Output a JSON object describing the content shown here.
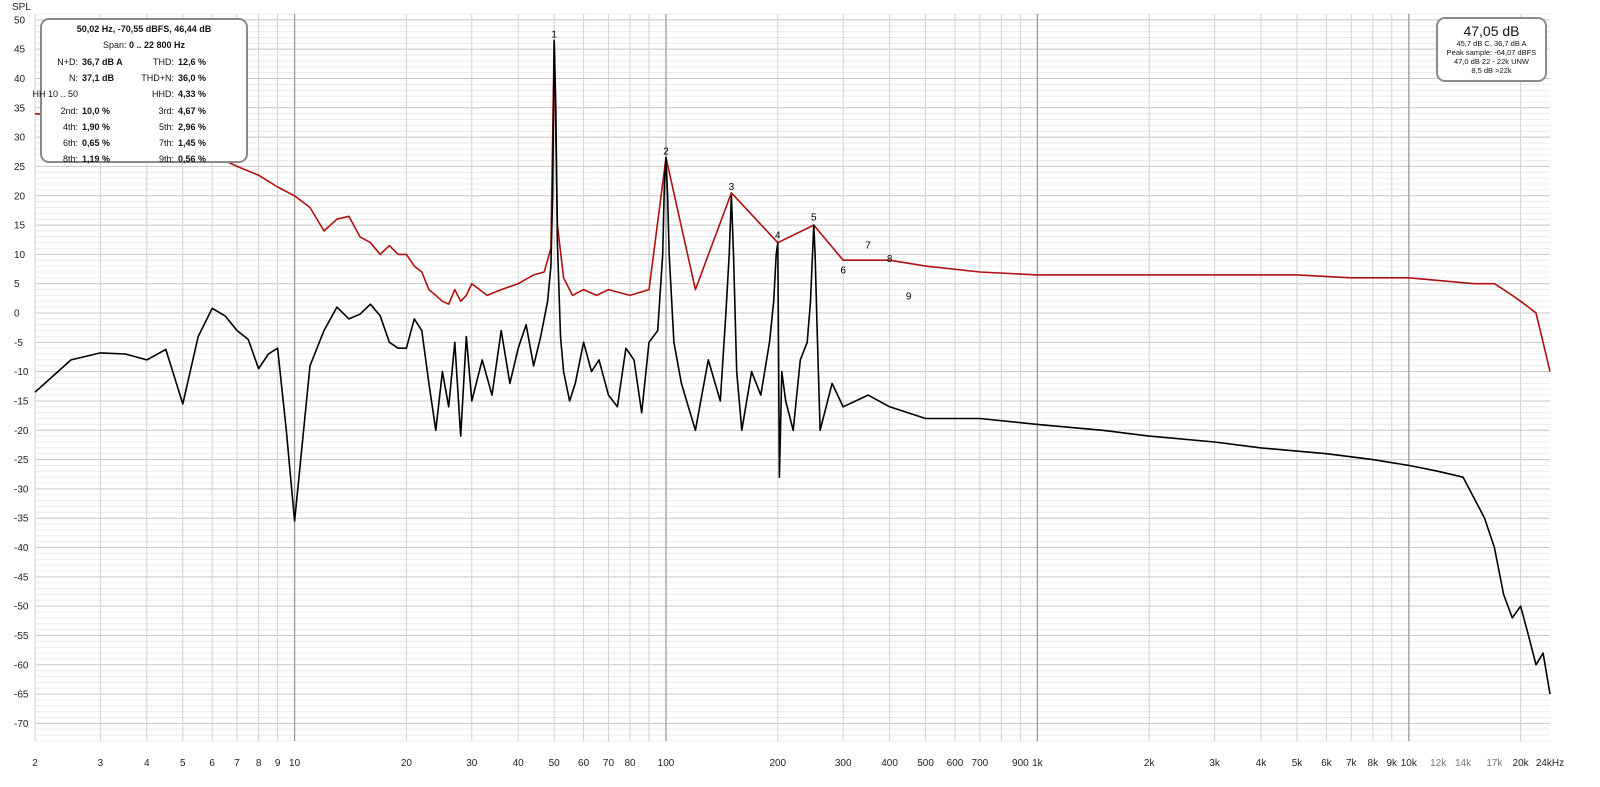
{
  "chart_data": {
    "type": "line",
    "ylabel": "SPL",
    "x_scale": "log",
    "xlim": [
      2,
      24000
    ],
    "ylim": [
      -73,
      51
    ],
    "y_ticks": [
      50,
      45,
      40,
      35,
      30,
      25,
      20,
      15,
      10,
      5,
      0,
      -5,
      -10,
      -15,
      -20,
      -25,
      -30,
      -35,
      -40,
      -45,
      -50,
      -55,
      -60,
      -65,
      -70
    ],
    "x_ticks": [
      {
        "v": 2,
        "label": "2"
      },
      {
        "v": 3,
        "label": "3"
      },
      {
        "v": 4,
        "label": "4"
      },
      {
        "v": 5,
        "label": "5"
      },
      {
        "v": 6,
        "label": "6"
      },
      {
        "v": 7,
        "label": "7"
      },
      {
        "v": 8,
        "label": "8"
      },
      {
        "v": 9,
        "label": "9"
      },
      {
        "v": 10,
        "label": "10"
      },
      {
        "v": 20,
        "label": "20"
      },
      {
        "v": 30,
        "label": "30"
      },
      {
        "v": 40,
        "label": "40"
      },
      {
        "v": 50,
        "label": "50"
      },
      {
        "v": 60,
        "label": "60"
      },
      {
        "v": 70,
        "label": "70"
      },
      {
        "v": 80,
        "label": "80"
      },
      {
        "v": 100,
        "label": "100"
      },
      {
        "v": 200,
        "label": "200"
      },
      {
        "v": 300,
        "label": "300"
      },
      {
        "v": 400,
        "label": "400"
      },
      {
        "v": 500,
        "label": "500"
      },
      {
        "v": 600,
        "label": "600"
      },
      {
        "v": 700,
        "label": "700"
      },
      {
        "v": 900,
        "label": "900"
      },
      {
        "v": 1000,
        "label": "1k"
      },
      {
        "v": 2000,
        "label": "2k"
      },
      {
        "v": 3000,
        "label": "3k"
      },
      {
        "v": 4000,
        "label": "4k"
      },
      {
        "v": 5000,
        "label": "5k"
      },
      {
        "v": 6000,
        "label": "6k"
      },
      {
        "v": 7000,
        "label": "7k"
      },
      {
        "v": 8000,
        "label": "8k"
      },
      {
        "v": 9000,
        "label": "9k"
      },
      {
        "v": 10000,
        "label": "10k"
      },
      {
        "v": 12000,
        "label": "12k",
        "dim": true
      },
      {
        "v": 14000,
        "label": "14k",
        "dim": true
      },
      {
        "v": 17000,
        "label": "17k",
        "dim": true
      },
      {
        "v": 20000,
        "label": "20k"
      },
      {
        "v": 24000,
        "label": "24kHz"
      }
    ],
    "series": [
      {
        "color": "#000000",
        "x": [
          2,
          2.5,
          3,
          3.5,
          4,
          4.5,
          5,
          5.5,
          6,
          6.5,
          7,
          7.5,
          8,
          8.5,
          9,
          9.5,
          10,
          11,
          12,
          13,
          14,
          15,
          16,
          17,
          18,
          19,
          20,
          21,
          22,
          23,
          24,
          25,
          26,
          27,
          28,
          29,
          30,
          32,
          34,
          36,
          38,
          40,
          42,
          44,
          46,
          48,
          49,
          49.5,
          50,
          50.5,
          51,
          52,
          53,
          55,
          57,
          60,
          63,
          66,
          70,
          74,
          78,
          82,
          86,
          90,
          95,
          98,
          99,
          100,
          101,
          102,
          105,
          110,
          120,
          130,
          140,
          145,
          148,
          150,
          152,
          155,
          160,
          170,
          180,
          190,
          195,
          198,
          200,
          202,
          205,
          210,
          220,
          230,
          240,
          245,
          248,
          250,
          252,
          255,
          260,
          280,
          300,
          350,
          400,
          500,
          700,
          1000,
          1500,
          2000,
          3000,
          4000,
          6000,
          8000,
          10000,
          12000,
          14000,
          16000,
          17000,
          18000,
          19000,
          20000,
          21000,
          22000,
          23000,
          24000
        ],
        "y": [
          -13.5,
          -8,
          -6.8,
          -7,
          -8,
          -6.2,
          -15.5,
          -4,
          0.8,
          -0.5,
          -3,
          -4.5,
          -9.5,
          -7,
          -6,
          -20,
          -35.5,
          -9,
          -3,
          1,
          -1,
          -0.2,
          1.5,
          -0.5,
          -5,
          -6,
          -6,
          -1,
          -3,
          -12,
          -20,
          -10,
          -16,
          -5,
          -21,
          -4,
          -15,
          -8,
          -14,
          -3,
          -12,
          -6,
          -2,
          -9,
          -4,
          2,
          8,
          20,
          46.5,
          35,
          12,
          -4,
          -10,
          -15,
          -12,
          -5,
          -10,
          -8,
          -14,
          -16,
          -6,
          -8,
          -17,
          -5,
          -3,
          10,
          22,
          26.5,
          20,
          10,
          -5,
          -12,
          -20,
          -8,
          -15,
          0,
          10,
          20,
          10,
          -10,
          -20,
          -10,
          -14,
          -5,
          2,
          10,
          12,
          -28,
          -10,
          -15,
          -20,
          -8,
          -5,
          2,
          10,
          15,
          10,
          -2,
          -20,
          -12,
          -16,
          -14,
          -16,
          -18,
          -18,
          -19,
          -20,
          -21,
          -22,
          -23,
          -24,
          -25,
          -26,
          -27,
          -28,
          -35,
          -40,
          -48,
          -52,
          -50,
          -55,
          -60,
          -58,
          -65
        ]
      },
      {
        "color": "#b01010",
        "x": [
          2,
          3,
          4,
          5,
          6,
          7,
          8,
          9,
          10,
          11,
          12,
          13,
          14,
          15,
          16,
          17,
          18,
          19,
          20,
          21,
          22,
          23,
          24,
          25,
          26,
          27,
          28,
          29,
          30,
          33,
          36,
          40,
          44,
          47,
          49,
          50,
          51,
          53,
          56,
          60,
          65,
          70,
          80,
          90,
          100,
          120,
          150,
          200,
          250,
          300,
          400,
          500,
          700,
          1000,
          1500,
          2000,
          3000,
          5000,
          7000,
          10000,
          15000,
          17000,
          18000,
          19000,
          20000,
          21000,
          22000,
          23000,
          24000
        ],
        "y": [
          34,
          33,
          31,
          29,
          27,
          25,
          23.5,
          21.5,
          20,
          18,
          14,
          16,
          16.5,
          13,
          12,
          10,
          11.5,
          10,
          10,
          8,
          7,
          4,
          3,
          2,
          1.5,
          4,
          2,
          3,
          5,
          3,
          4,
          5,
          6.5,
          7,
          11,
          46.5,
          15,
          6,
          3,
          4,
          3,
          4,
          3,
          4,
          26.5,
          4,
          20.5,
          12,
          15,
          9,
          9,
          8,
          7,
          6.5,
          6.5,
          6.5,
          6.5,
          6.5,
          6,
          6,
          5,
          5,
          4,
          3,
          2,
          1,
          0,
          -5,
          -10
        ]
      }
    ],
    "harmonic_labels": [
      {
        "label": "1",
        "x": 50,
        "y": 46.5
      },
      {
        "label": "2",
        "x": 100,
        "y": 26.5
      },
      {
        "label": "3",
        "x": 150,
        "y": 20.5
      },
      {
        "label": "4",
        "x": 200,
        "y": 12.2
      },
      {
        "label": "5",
        "x": 250,
        "y": 15.3
      },
      {
        "label": "6",
        "x": 300,
        "y": 6.2
      },
      {
        "label": "7",
        "x": 350,
        "y": 10.5
      },
      {
        "label": "8",
        "x": 400,
        "y": 8.2
      },
      {
        "label": "9",
        "x": 450,
        "y": 1.8
      }
    ]
  },
  "info_box": {
    "cursor": "50,02 Hz, -70,55 dBFS, 46,44 dB",
    "span_label": "Span:",
    "span_value": "0 .. 22 800 Hz",
    "rows": [
      {
        "k1": "N+D:",
        "v1": "36,7 dB A",
        "k2": "THD:",
        "v2": "12,6 %"
      },
      {
        "k1": "N:",
        "v1": "37,1 dB",
        "k2": "THD+N:",
        "v2": "36,0 %"
      },
      {
        "k1": "HH 10 .. 50",
        "v1": "",
        "k2": "HHD:",
        "v2": "4,33 %"
      },
      {
        "k1": "2nd:",
        "v1": "10,0 %",
        "k2": "3rd:",
        "v2": "4,67 %"
      },
      {
        "k1": "4th:",
        "v1": "1,90 %",
        "k2": "5th:",
        "v2": "2,96 %"
      },
      {
        "k1": "6th:",
        "v1": "0,65 %",
        "k2": "7th:",
        "v2": "1,45 %"
      },
      {
        "k1": "8th:",
        "v1": "1,19 %",
        "k2": "9th:",
        "v2": "0,56 %"
      }
    ]
  },
  "level_box": {
    "main": "47,05 dB",
    "lines": [
      "45,7 dB C, 36,7 dB A",
      "Peak sample: -64,07 dBFS",
      "47,0 dB 22 - 22k UNW",
      "8,5 dB >22k"
    ]
  }
}
